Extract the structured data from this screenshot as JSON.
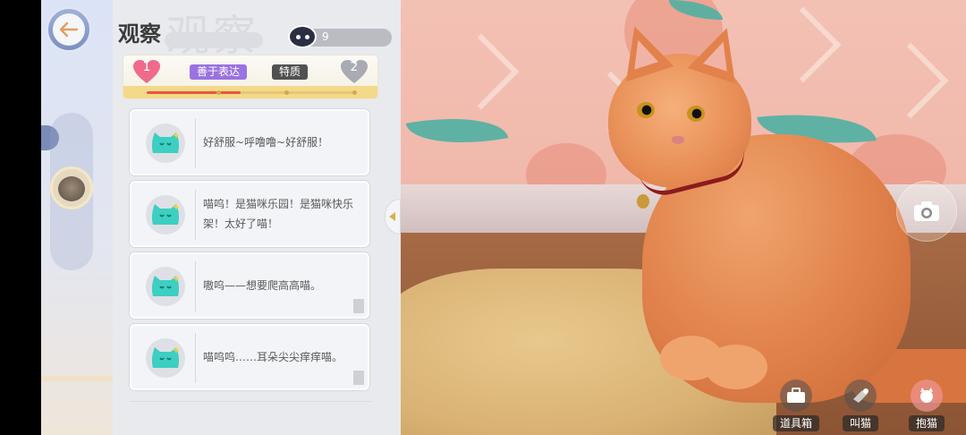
{
  "header": {
    "title": "观察",
    "energy_value": "9"
  },
  "trait": {
    "left_heart": "1",
    "right_heart": "2",
    "tag_primary": "善于表达",
    "tag_secondary": "特质",
    "progress_fraction": 0.45
  },
  "observations": [
    {
      "text": "好舒服~呼噜噜~好舒服！"
    },
    {
      "text": "喵呜！是猫咪乐园！是猫咪快乐架！太好了喵！"
    },
    {
      "text": "嗷呜——想要爬高高喵。"
    },
    {
      "text": "喵呜呜……耳朵尖尖痒痒喵。"
    }
  ],
  "actions": {
    "toolbox": "道具箱",
    "call_cat": "叫猫",
    "hug_cat": "抱猫"
  },
  "colors": {
    "accent_purple": "#9b72e1",
    "heart_pink": "#f06a8c",
    "teal_cat": "#3ccfc2"
  },
  "icons": {
    "back": "back-arrow-icon",
    "energy": "cat-head-icon",
    "camera": "camera-icon",
    "card": "cat-face-icon"
  }
}
